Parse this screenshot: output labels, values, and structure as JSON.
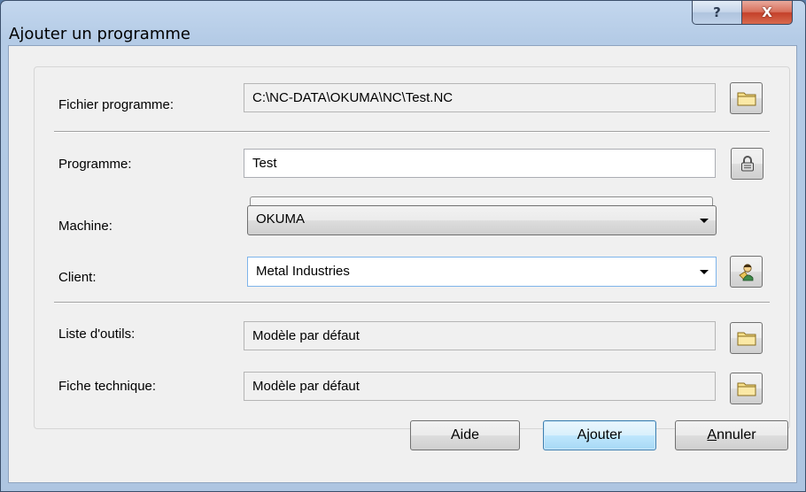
{
  "window": {
    "title": "Ajouter un programme",
    "help_glyph": "?",
    "close_glyph": "X"
  },
  "fields": {
    "fichier_programme": {
      "label": "Fichier programme:",
      "value": "C:\\NC-DATA\\OKUMA\\NC\\Test.NC"
    },
    "programme": {
      "label": "Programme:",
      "value": "Test"
    },
    "machine": {
      "label": "Machine:",
      "value": "OKUMA"
    },
    "client": {
      "label": "Client:",
      "value": "Metal Industries"
    },
    "liste_outils": {
      "label": "Liste d'outils:",
      "value": "Modèle par défaut"
    },
    "fiche_technique": {
      "label": "Fiche technique:",
      "value": "Modèle par défaut"
    }
  },
  "icons": {
    "browse": "folder-icon",
    "lock": "lock-icon",
    "client": "person-icon"
  },
  "buttons": {
    "help": "Aide",
    "add": "Ajouter",
    "cancel": "Annuler"
  },
  "colors": {
    "title_bar": "#b4cbe6",
    "close_button": "#c4402a",
    "default_button": "#bee6fd",
    "client_focus_border": "#7eb4ea"
  }
}
